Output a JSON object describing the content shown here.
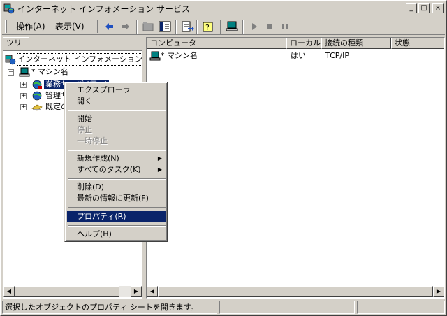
{
  "window": {
    "title": "インターネット インフォメーション サービス",
    "controls": {
      "minimize": "_",
      "maximize": "□",
      "close": "×"
    }
  },
  "menu": {
    "action": "操作(A)",
    "view": "表示(V)"
  },
  "toolbar": {
    "buttons": [
      "back-icon",
      "forward-icon",
      "up-folder-icon",
      "show-hide-tree-icon",
      "export-list-icon",
      "help-icon",
      "computer-icon",
      "play-icon",
      "stop-icon",
      "pause-icon"
    ]
  },
  "tree": {
    "tab_label": "ツリー",
    "root": "インターネット インフォメーション サービス",
    "machine": "* マシン名",
    "children": [
      {
        "label": "業務サーバ (停止)",
        "selected": true
      },
      {
        "label": "管理サ"
      },
      {
        "label": "既定の"
      }
    ]
  },
  "list": {
    "columns": [
      "コンピュータ",
      "ローカル",
      "接続の種類",
      "状態"
    ],
    "rows": [
      {
        "computer": "* マシン名",
        "local": "はい",
        "connection": "TCP/IP",
        "status": ""
      }
    ]
  },
  "context_menu": {
    "items": [
      {
        "label": "エクスプローラ",
        "state": "normal"
      },
      {
        "label": "開く",
        "state": "normal"
      },
      {
        "separator": true
      },
      {
        "label": "開始",
        "state": "normal"
      },
      {
        "label": "停止",
        "state": "disabled"
      },
      {
        "label": "一時停止",
        "state": "disabled"
      },
      {
        "separator": true
      },
      {
        "label": "新規作成(N)",
        "state": "normal",
        "submenu": true
      },
      {
        "label": "すべてのタスク(K)",
        "state": "normal",
        "submenu": true
      },
      {
        "separator": true
      },
      {
        "label": "削除(D)",
        "state": "normal"
      },
      {
        "label": "最新の情報に更新(F)",
        "state": "normal"
      },
      {
        "separator": true
      },
      {
        "label": "プロパティ(R)",
        "state": "highlighted"
      },
      {
        "separator": true
      },
      {
        "label": "ヘルプ(H)",
        "state": "normal"
      }
    ]
  },
  "statusbar": {
    "message": "選択したオブジェクトのプロパティ シートを開きます。",
    "panel2": "",
    "panel3": ""
  },
  "colors": {
    "face": "#d4d0c8",
    "selection": "#0a246a",
    "highlight_text": "#ffffff"
  }
}
